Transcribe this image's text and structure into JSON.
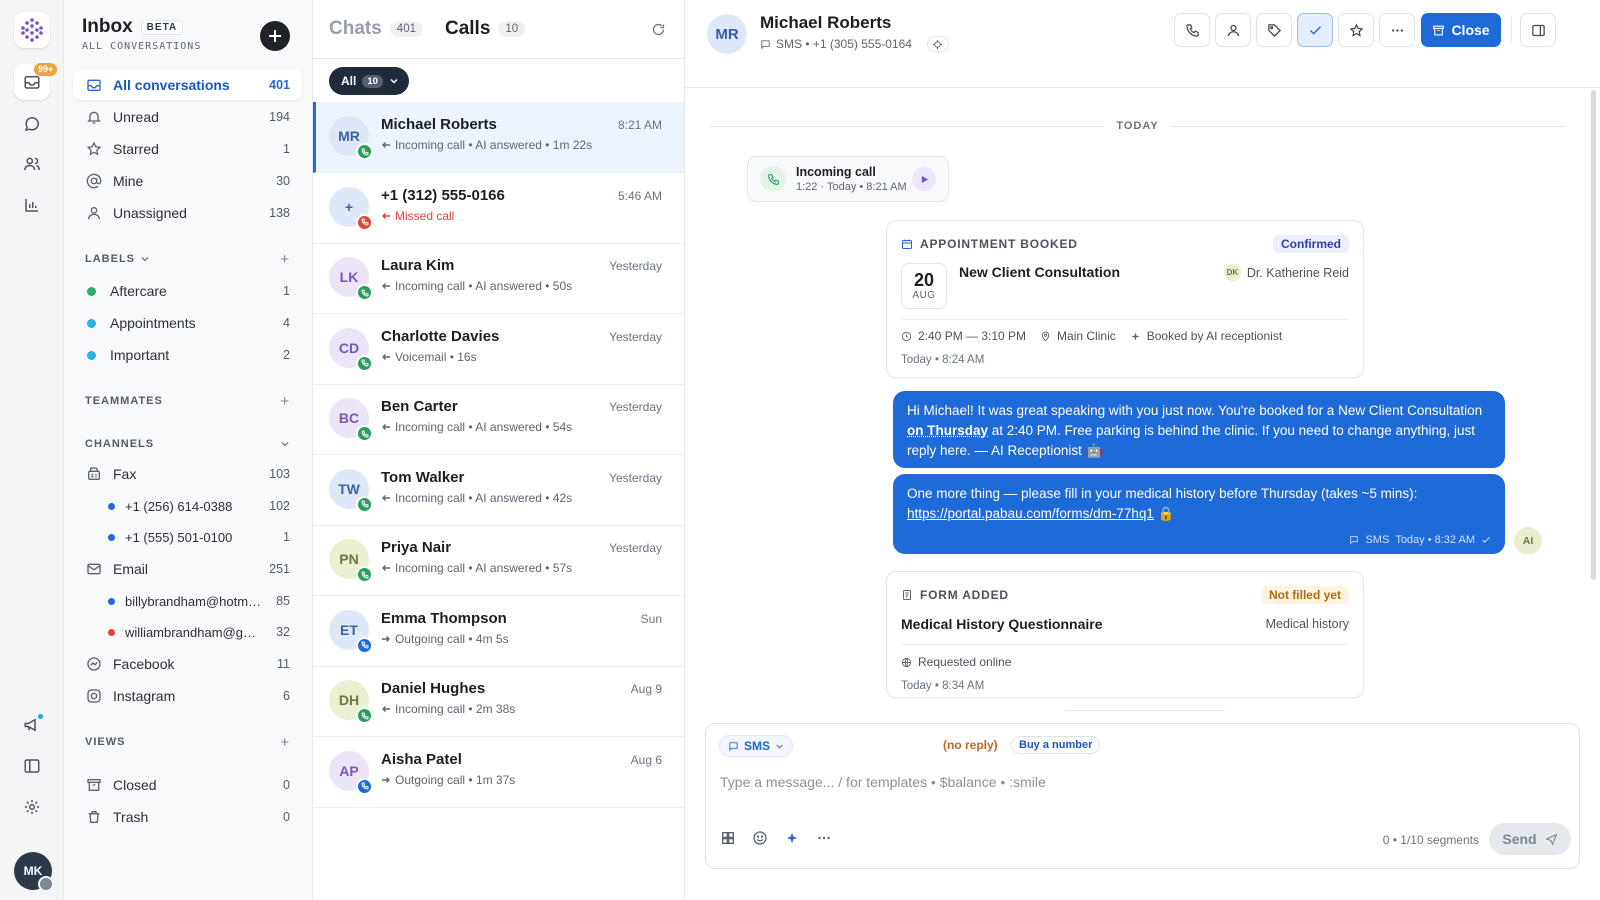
{
  "rail": {
    "badge": "99+",
    "user_initials": "MK"
  },
  "inbox": {
    "title": "Inbox",
    "beta": "BETA",
    "subtitle": "ALL CONVERSATIONS",
    "nav": [
      {
        "label": "All conversations",
        "count": "401"
      },
      {
        "label": "Unread",
        "count": "194"
      },
      {
        "label": "Starred",
        "count": "1"
      },
      {
        "label": "Mine",
        "count": "30"
      },
      {
        "label": "Unassigned",
        "count": "138"
      }
    ],
    "labels_title": "LABELS",
    "labels": [
      {
        "label": "Aftercare",
        "count": "1",
        "color": "#2fae66"
      },
      {
        "label": "Appointments",
        "count": "4",
        "color": "#2fb0e0"
      },
      {
        "label": "Important",
        "count": "2",
        "color": "#2fb0e0"
      }
    ],
    "teammates_title": "TEAMMATES",
    "channels_title": "CHANNELS",
    "channels": [
      {
        "label": "Fax",
        "count": "103"
      },
      {
        "label": "+1 (256) 614-0388",
        "count": "102",
        "color": "#2a66d9"
      },
      {
        "label": "+1 (555) 501-0100",
        "count": "1",
        "color": "#2a66d9"
      },
      {
        "label": "Email",
        "count": "251"
      },
      {
        "label": "billybrandham@hotmail...",
        "count": "85",
        "color": "#2a66d9"
      },
      {
        "label": "williambrandham@gma...",
        "count": "32",
        "color": "#e0443a"
      },
      {
        "label": "Facebook",
        "count": "11"
      },
      {
        "label": "Instagram",
        "count": "6"
      }
    ],
    "views_title": "VIEWS",
    "views": [
      {
        "label": "Closed",
        "count": "0"
      },
      {
        "label": "Trash",
        "count": "0"
      }
    ]
  },
  "list": {
    "tabs": [
      {
        "label": "Chats",
        "count": "401"
      },
      {
        "label": "Calls",
        "count": "10"
      }
    ],
    "filter": {
      "label": "All",
      "count": "10"
    },
    "rows": [
      {
        "initials": "MR",
        "name": "Michael Roberts",
        "meta": "Incoming call • AI answered • 1m 22s",
        "time": "8:21 AM",
        "bg": "#dfe8f8",
        "fg": "#3b63a8",
        "status": "#2a9d5a"
      },
      {
        "initials": "+",
        "name": "+1 (312) 555-0166",
        "meta": "Missed call",
        "time": "5:46 AM",
        "bg": "#dfe8f8",
        "fg": "#3b63a8",
        "status": "#e0443a"
      },
      {
        "initials": "LK",
        "name": "Laura Kim",
        "meta": "Incoming call • AI answered • 50s",
        "time": "Yesterday",
        "bg": "#ece5f8",
        "fg": "#7a55b8",
        "status": "#2a9d5a"
      },
      {
        "initials": "CD",
        "name": "Charlotte Davies",
        "meta": "Voicemail • 16s",
        "time": "Yesterday",
        "bg": "#ece5f8",
        "fg": "#7a55b8",
        "status": "#2a9d5a"
      },
      {
        "initials": "BC",
        "name": "Ben Carter",
        "meta": "Incoming call • AI answered • 54s",
        "time": "Yesterday",
        "bg": "#ece5f8",
        "fg": "#7a55b8",
        "status": "#2a9d5a"
      },
      {
        "initials": "TW",
        "name": "Tom Walker",
        "meta": "Incoming call • AI answered • 42s",
        "time": "Yesterday",
        "bg": "#dfe8f8",
        "fg": "#3b63a8",
        "status": "#2a9d5a"
      },
      {
        "initials": "PN",
        "name": "Priya Nair",
        "meta": "Incoming call • AI answered • 57s",
        "time": "Yesterday",
        "bg": "#eaf0d2",
        "fg": "#6c7a3a",
        "status": "#2a9d5a"
      },
      {
        "initials": "ET",
        "name": "Emma Thompson",
        "meta": "Outgoing call • 4m 5s",
        "time": "Sun",
        "bg": "#dfe8f8",
        "fg": "#3b63a8",
        "status": "#1d6ad8"
      },
      {
        "initials": "DH",
        "name": "Daniel Hughes",
        "meta": "Incoming call • 2m 38s",
        "time": "Aug 9",
        "bg": "#eaf0d2",
        "fg": "#6c7a3a",
        "status": "#2a9d5a"
      },
      {
        "initials": "AP",
        "name": "Aisha Patel",
        "meta": "Outgoing call • 1m 37s",
        "time": "Aug 6",
        "bg": "#ece5f8",
        "fg": "#7a55b8",
        "status": "#1d6ad8"
      }
    ]
  },
  "conversation": {
    "initials": "MR",
    "name": "Michael Roberts",
    "subtitle": "SMS • +1 (305) 555-0164",
    "close_label": "Close",
    "day_label": "TODAY",
    "call": {
      "title": "Incoming call",
      "meta": "1:22 · Today • 8:21 AM"
    },
    "appointment": {
      "heading": "APPOINTMENT BOOKED",
      "status": "Confirmed",
      "day": "20",
      "month": "AUG",
      "title": "New Client Consultation",
      "staff_initials": "DK",
      "staff": "Dr. Katherine Reid",
      "time": "2:40 PM — 3:10 PM",
      "location": "Main Clinic",
      "booked_by": "Booked by AI receptionist",
      "timestamp": "Today • 8:24 AM"
    },
    "messages": [
      {
        "pre": "Hi Michael! It was great speaking with you just now. You're booked for a New Client Consultation ",
        "emph": "on Thursday",
        "post": " at 2:40 PM. Free parking is behind the clinic. If you need to change anything, just reply here. — AI Receptionist 🤖"
      },
      {
        "pre": "One more thing — please fill in your medical history before Thursday (takes ~5 mins): ",
        "link": "https://portal.pabau.com/forms/dm-77hq1",
        "post": " 🔒",
        "channel": "SMS",
        "time": "Today • 8:32 AM"
      }
    ],
    "sender_initials": "AI",
    "form": {
      "heading": "FORM ADDED",
      "status": "Not filled yet",
      "title": "Medical History Questionnaire",
      "category": "Medical history",
      "requested": "Requested online",
      "timestamp": "Today • 8:34 AM"
    },
    "composer": {
      "channel": "SMS",
      "no_reply": "(no reply)",
      "buy_number": "Buy a number",
      "placeholder": "Type a message...  /  for templates  •  $balance  •  :smile",
      "segments": "0 • 1/10 segments",
      "send": "Send"
    }
  },
  "colors": {
    "accent": "#1d6ad8",
    "confirmed": "#2b3fb0",
    "not_filled": "#b06a10"
  }
}
